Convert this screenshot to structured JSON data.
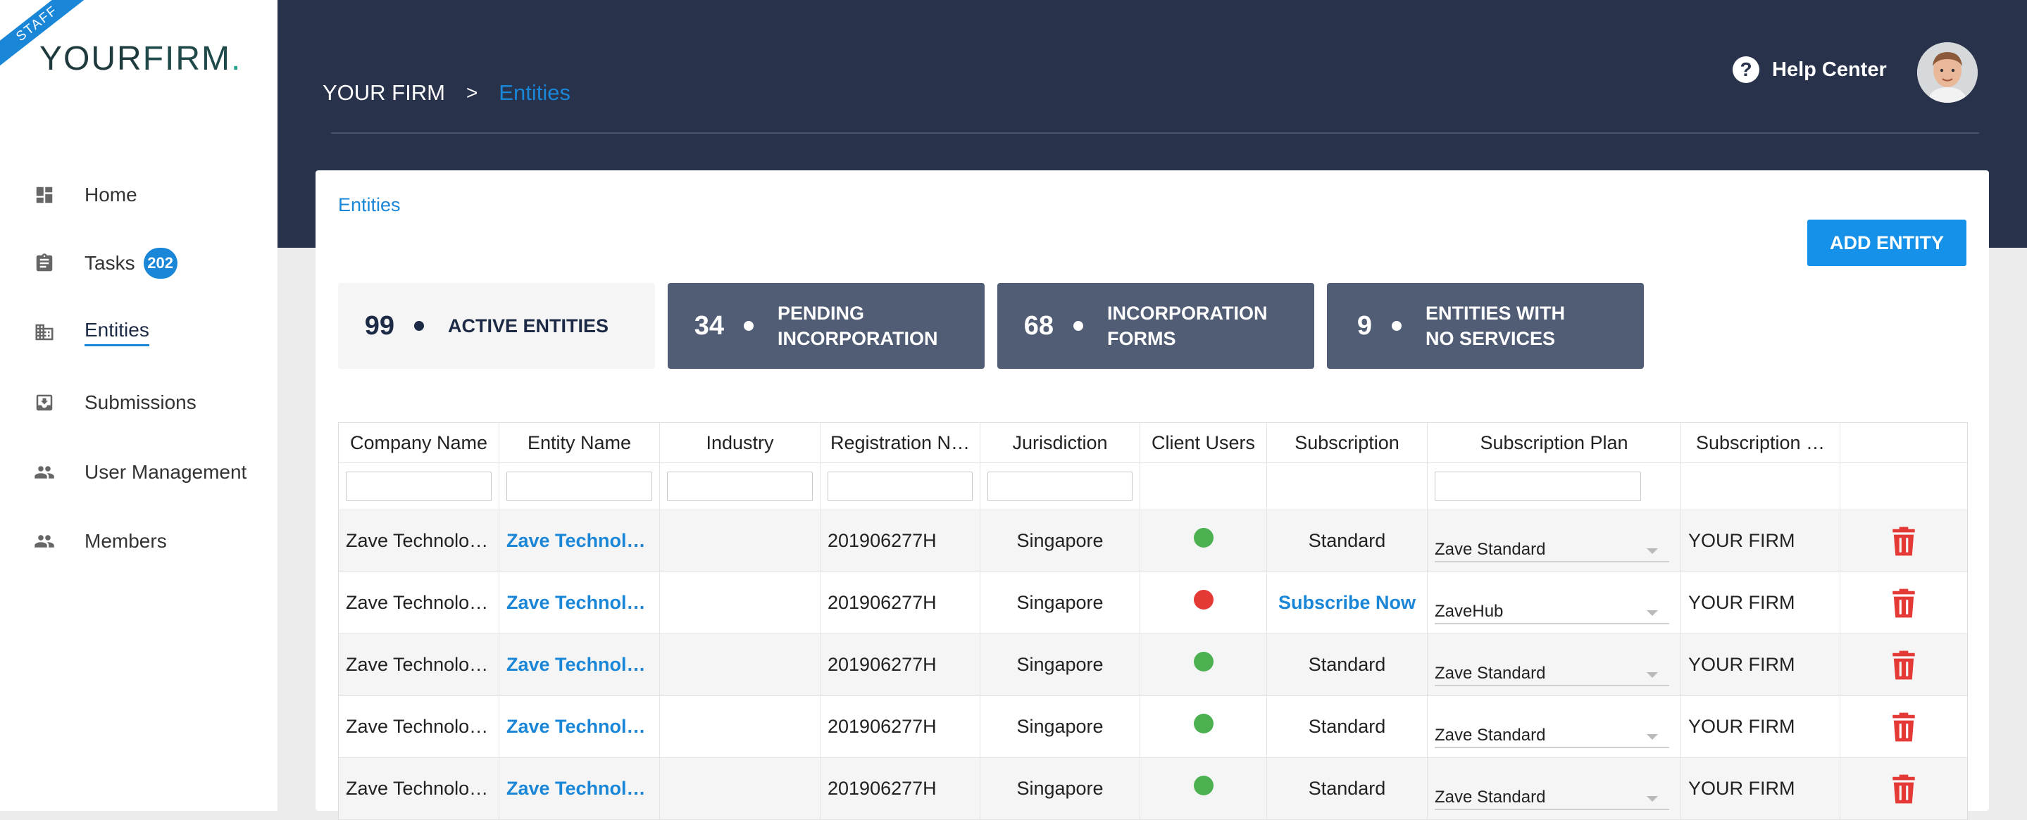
{
  "sidebar": {
    "ribbon": "STAFF",
    "logo": {
      "bold": "YOUR",
      "light": "FIRM",
      "dot": "."
    },
    "items": [
      {
        "label": "Home",
        "icon": "dashboard-icon"
      },
      {
        "label": "Tasks",
        "icon": "clipboard-icon",
        "badge": "202"
      },
      {
        "label": "Entities",
        "icon": "building-icon",
        "active": true
      },
      {
        "label": "Submissions",
        "icon": "inbox-icon"
      },
      {
        "label": "User Management",
        "icon": "people-icon"
      },
      {
        "label": "Members",
        "icon": "people-icon"
      }
    ]
  },
  "header": {
    "breadcrumb": {
      "root": "YOUR FIRM",
      "separator": ">",
      "current": "Entities"
    },
    "help_label": "Help Center"
  },
  "card": {
    "title": "Entities",
    "add_button": "ADD ENTITY",
    "stats": [
      {
        "value": "99",
        "label_line1": "ACTIVE ENTITIES",
        "label_line2": ""
      },
      {
        "value": "34",
        "label_line1": "PENDING",
        "label_line2": "INCORPORATION"
      },
      {
        "value": "68",
        "label_line1": "INCORPORATION",
        "label_line2": "FORMS"
      },
      {
        "value": "9",
        "label_line1": "ENTITIES WITH",
        "label_line2": "NO SERVICES"
      }
    ]
  },
  "table": {
    "columns": [
      "Company Name",
      "Entity Name",
      "Industry",
      "Registration N…",
      "Jurisdiction",
      "Client Users",
      "Subscription",
      "Subscription Plan",
      "Subscription …",
      ""
    ],
    "rows": [
      {
        "company": "Zave Technolo…",
        "entity": "Zave Technol…",
        "industry": "",
        "registration": "201906277H",
        "jurisdiction": "Singapore",
        "client_status": "green",
        "subscription": "Standard",
        "subscription_link": false,
        "plan": "Zave Standard",
        "provider": "YOUR FIRM"
      },
      {
        "company": "Zave Technolo…",
        "entity": "Zave Technol…",
        "industry": "",
        "registration": "201906277H",
        "jurisdiction": "Singapore",
        "client_status": "red",
        "subscription": "Subscribe Now",
        "subscription_link": true,
        "plan": "ZaveHub",
        "provider": "YOUR FIRM"
      },
      {
        "company": "Zave Technolo…",
        "entity": "Zave Technol…",
        "industry": "",
        "registration": "201906277H",
        "jurisdiction": "Singapore",
        "client_status": "green",
        "subscription": "Standard",
        "subscription_link": false,
        "plan": "Zave Standard",
        "provider": "YOUR FIRM"
      },
      {
        "company": "Zave Technolo…",
        "entity": "Zave Technol…",
        "industry": "",
        "registration": "201906277H",
        "jurisdiction": "Singapore",
        "client_status": "green",
        "subscription": "Standard",
        "subscription_link": false,
        "plan": "Zave Standard",
        "provider": "YOUR FIRM"
      },
      {
        "company": "Zave Technolo…",
        "entity": "Zave Technol…",
        "industry": "",
        "registration": "201906277H",
        "jurisdiction": "Singapore",
        "client_status": "green",
        "subscription": "Standard",
        "subscription_link": false,
        "plan": "Zave Standard",
        "provider": "YOUR FIRM"
      }
    ]
  },
  "colors": {
    "accent": "#1a86d8",
    "header_bg": "#28324a",
    "stat_dark": "#515d75",
    "status_green": "#4caf50",
    "status_red": "#e53935",
    "trash_red": "#e53935"
  }
}
